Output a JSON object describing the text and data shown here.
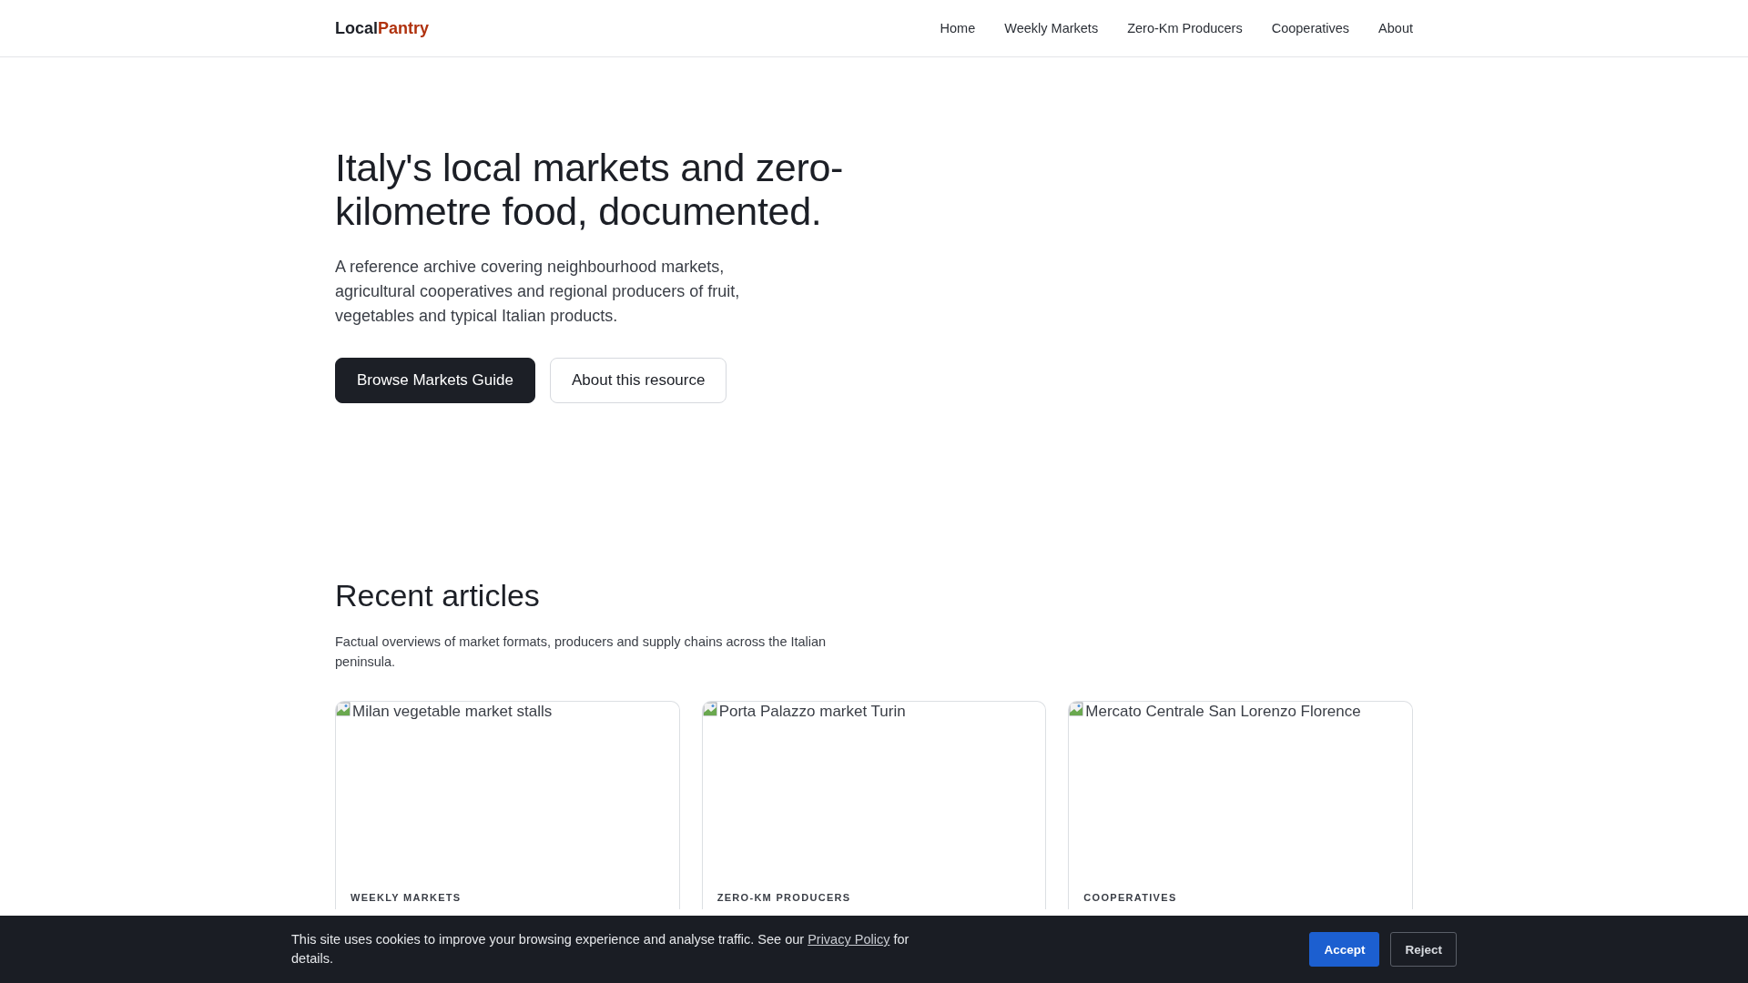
{
  "header": {
    "logo": {
      "first": "Local",
      "second": "Pantry"
    },
    "nav": [
      "Home",
      "Weekly Markets",
      "Zero-Km Producers",
      "Cooperatives",
      "About"
    ]
  },
  "hero": {
    "title": "Italy's local markets and zero-kilometre food, documented.",
    "text": "A reference archive covering neighbourhood markets, agricultural cooperatives and regional producers of fruit, vegetables and typical Italian products.",
    "buttons": [
      {
        "label": "Browse Markets Guide",
        "kind": "primary"
      },
      {
        "label": "About this resource",
        "kind": "secondary"
      }
    ]
  },
  "articles": {
    "title": "Recent articles",
    "text": "Factual overviews of market formats, producers and supply chains across the Italian peninsula.",
    "cards": [
      {
        "image_alt": "Milan vegetable market stalls",
        "category": "WEEKLY MARKETS"
      },
      {
        "image_alt": "Porta Palazzo market Turin",
        "category": "ZERO-KM PRODUCERS"
      },
      {
        "image_alt": "Mercato Centrale San Lorenzo Florence",
        "category": "COOPERATIVES"
      }
    ]
  },
  "cookie_bar": {
    "text": "This site uses cookies to improve your browsing experience and analyse traffic. See our",
    "link": "Privacy Policy",
    "text_after": "for details.",
    "buttons": [
      {
        "label": "Accept",
        "kind": "primary"
      },
      {
        "label": "Reject",
        "kind": "secondary"
      }
    ]
  }
}
